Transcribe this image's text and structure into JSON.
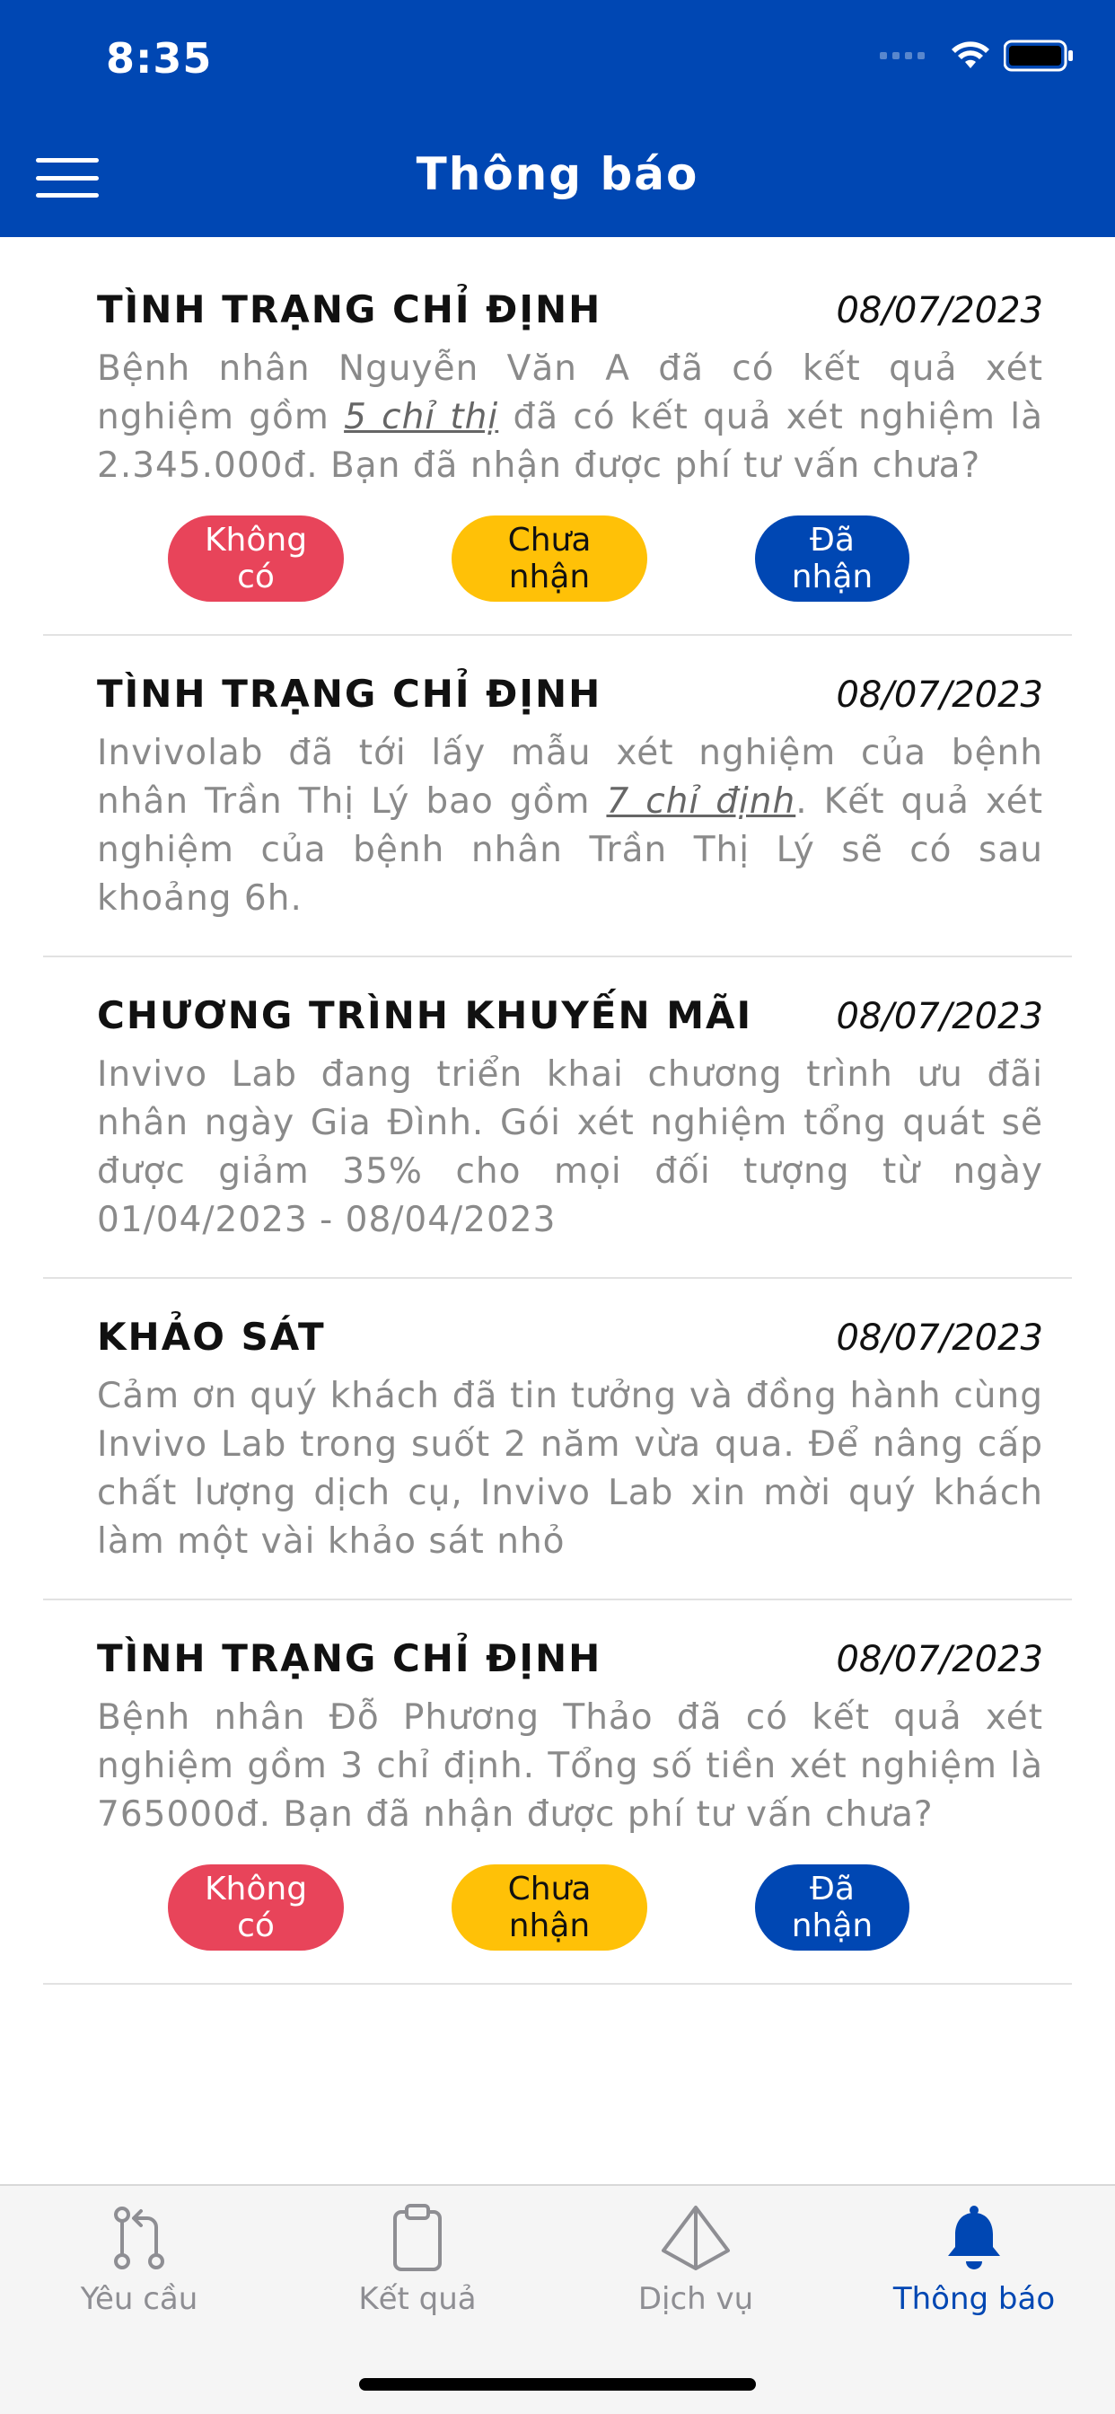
{
  "status_bar": {
    "time": "8:35"
  },
  "header": {
    "title": "Thông báo"
  },
  "notifications": [
    {
      "title": "TÌNH TRẠNG CHỈ ĐỊNH",
      "date": "08/07/2023",
      "body_pre": "Bệnh nhân Nguyễn Văn A đã có kết quả xét nghiệm gồm ",
      "body_link": "5 chỉ thị",
      "body_post": " đã có kết quả xét nghiệm là 2.345.000đ. Bạn đã nhận được phí tư vấn chưa?",
      "actions": {
        "no": "Không có",
        "pending": "Chưa nhận",
        "yes": "Đã nhận"
      }
    },
    {
      "title": "TÌNH TRẠNG CHỈ ĐỊNH",
      "date": "08/07/2023",
      "body_pre": "Invivolab đã tới lấy mẫu xét nghiệm của bệnh nhân Trần Thị Lý bao gồm ",
      "body_link": "7 chỉ định",
      "body_post": ". Kết quả xét nghiệm của bệnh nhân Trần Thị Lý sẽ có sau khoảng 6h."
    },
    {
      "title": "CHƯƠNG TRÌNH KHUYẾN MÃI",
      "date": "08/07/2023",
      "body": "Invivo Lab đang triển khai chương trình ưu đãi nhân ngày Gia Đình. Gói xét nghiệm tổng quát sẽ được giảm 35% cho mọi đối tượng từ ngày 01/04/2023 - 08/04/2023"
    },
    {
      "title": "KHẢO SÁT",
      "date": "08/07/2023",
      "body": "Cảm ơn quý khách đã tin tưởng và đồng hành cùng Invivo Lab trong suốt 2 năm vừa qua. Để nâng cấp chất lượng dịch cụ, Invivo Lab xin mời quý khách làm một vài khảo sát nhỏ"
    },
    {
      "title": "TÌNH TRẠNG CHỈ ĐỊNH",
      "date": "08/07/2023",
      "body": "Bệnh nhân Đỗ Phương Thảo đã có kết quả xét nghiệm gồm 3 chỉ định. Tổng số tiền xét nghiệm là 765000đ. Bạn đã nhận được phí tư vấn chưa?",
      "actions": {
        "no": "Không có",
        "pending": "Chưa nhận",
        "yes": "Đã nhận"
      }
    }
  ],
  "tabs": [
    {
      "label": "Yêu cầu",
      "icon": "pull-request-icon",
      "active": false
    },
    {
      "label": "Kết quả",
      "icon": "clipboard-icon",
      "active": false
    },
    {
      "label": "Dịch vụ",
      "icon": "pyramid-icon",
      "active": false
    },
    {
      "label": "Thông báo",
      "icon": "bell-icon",
      "active": true
    }
  ],
  "colors": {
    "primary": "#0047b3",
    "danger": "#e8445a",
    "warning": "#ffc107",
    "muted_text": "#8a8a8a"
  }
}
